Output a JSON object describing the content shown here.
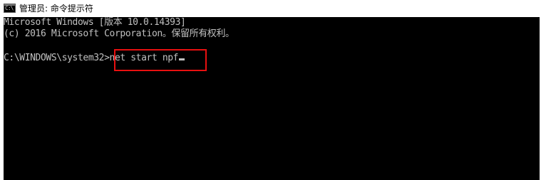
{
  "window": {
    "title": "管理员: 命令提示符",
    "icon": "cmd-icon",
    "icon_glyph": "C:\\"
  },
  "console": {
    "lines": [
      "Microsoft Windows [版本 10.0.14393]",
      "(c) 2016 Microsoft Corporation。保留所有权利。"
    ],
    "prompt": "C:\\WINDOWS\\system32>",
    "command": "net start npf"
  },
  "colors": {
    "console_background": "#000000",
    "console_text": "#c0c0c0",
    "highlight_border": "#e81010"
  }
}
